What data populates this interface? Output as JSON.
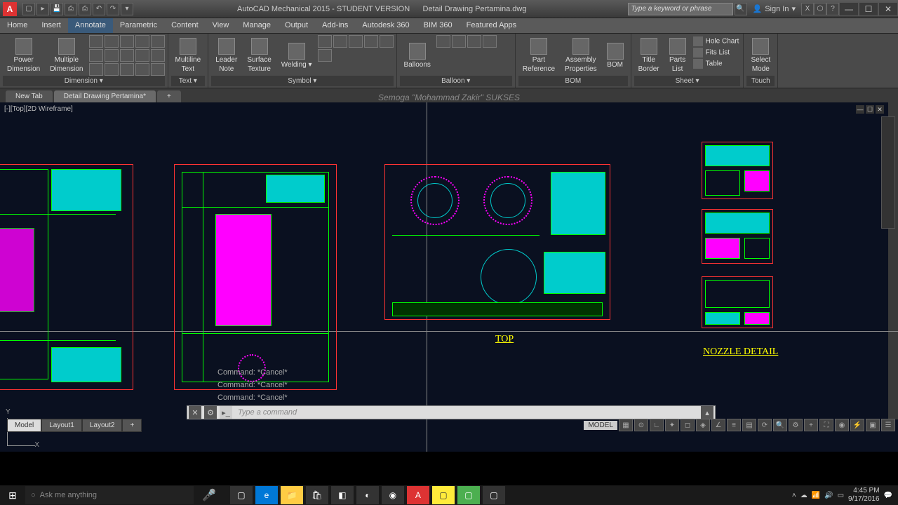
{
  "title": {
    "app": "AutoCAD Mechanical 2015 - STUDENT VERSION",
    "file": "Detail Drawing Pertamina.dwg"
  },
  "search": {
    "placeholder": "Type a keyword or phrase"
  },
  "signin": {
    "label": "Sign In"
  },
  "menu": [
    "Home",
    "Insert",
    "Annotate",
    "Parametric",
    "Content",
    "View",
    "Manage",
    "Output",
    "Add-ins",
    "Autodesk 360",
    "BIM 360",
    "Featured Apps"
  ],
  "active_menu": 2,
  "ribbon": {
    "panels": [
      {
        "title": "Dimension ▾",
        "big": [
          {
            "l": "Power\nDimension"
          },
          {
            "l": "Multiple\nDimension"
          }
        ],
        "grid": 15
      },
      {
        "title": "Text ▾",
        "big": [
          {
            "l": "Multiline\nText"
          }
        ],
        "grid": 0,
        "narrow": true
      },
      {
        "title": "Symbol ▾",
        "big": [
          {
            "l": "Leader\nNote"
          },
          {
            "l": "Surface\nTexture"
          },
          {
            "l": "Welding ▾"
          }
        ],
        "grid": 6
      },
      {
        "title": "Balloon ▾",
        "big": [
          {
            "l": "Balloons"
          }
        ],
        "grid": 4
      },
      {
        "title": "BOM",
        "big": [
          {
            "l": "Part\nReference"
          },
          {
            "l": "Assembly\nProperties"
          },
          {
            "l": "BOM"
          }
        ],
        "grid": 0
      },
      {
        "title": "Sheet ▾",
        "big": [
          {
            "l": "Title\nBorder"
          },
          {
            "l": "Parts\nList"
          }
        ],
        "side": [
          "Hole Chart",
          "Fits List",
          "Table"
        ]
      },
      {
        "title": "Touch",
        "big": [
          {
            "l": "Select\nMode"
          }
        ],
        "grid": 0
      }
    ]
  },
  "file_tabs": [
    {
      "l": "New Tab"
    },
    {
      "l": "Detail Drawing Pertamina*",
      "active": true
    },
    {
      "l": "+"
    }
  ],
  "watermark": "Semoga \"Mohammad Zakir\" SUKSES",
  "viewport_label": "[-][Top][2D Wireframe]",
  "drawing_labels": {
    "top": "TOP",
    "nozzle": "NOZZLE  DETAIL"
  },
  "cmd_history": [
    "Command: *Cancel*",
    "Command: *Cancel*",
    "Command: *Cancel*"
  ],
  "cmd_placeholder": "Type a command",
  "layout_tabs": [
    {
      "l": "Model",
      "active": true
    },
    {
      "l": "Layout1"
    },
    {
      "l": "Layout2"
    },
    {
      "l": "+"
    }
  ],
  "status": {
    "model": "MODEL"
  },
  "taskbar": {
    "search": "Ask me anything",
    "time": "4:45 PM",
    "date": "9/17/2016"
  }
}
